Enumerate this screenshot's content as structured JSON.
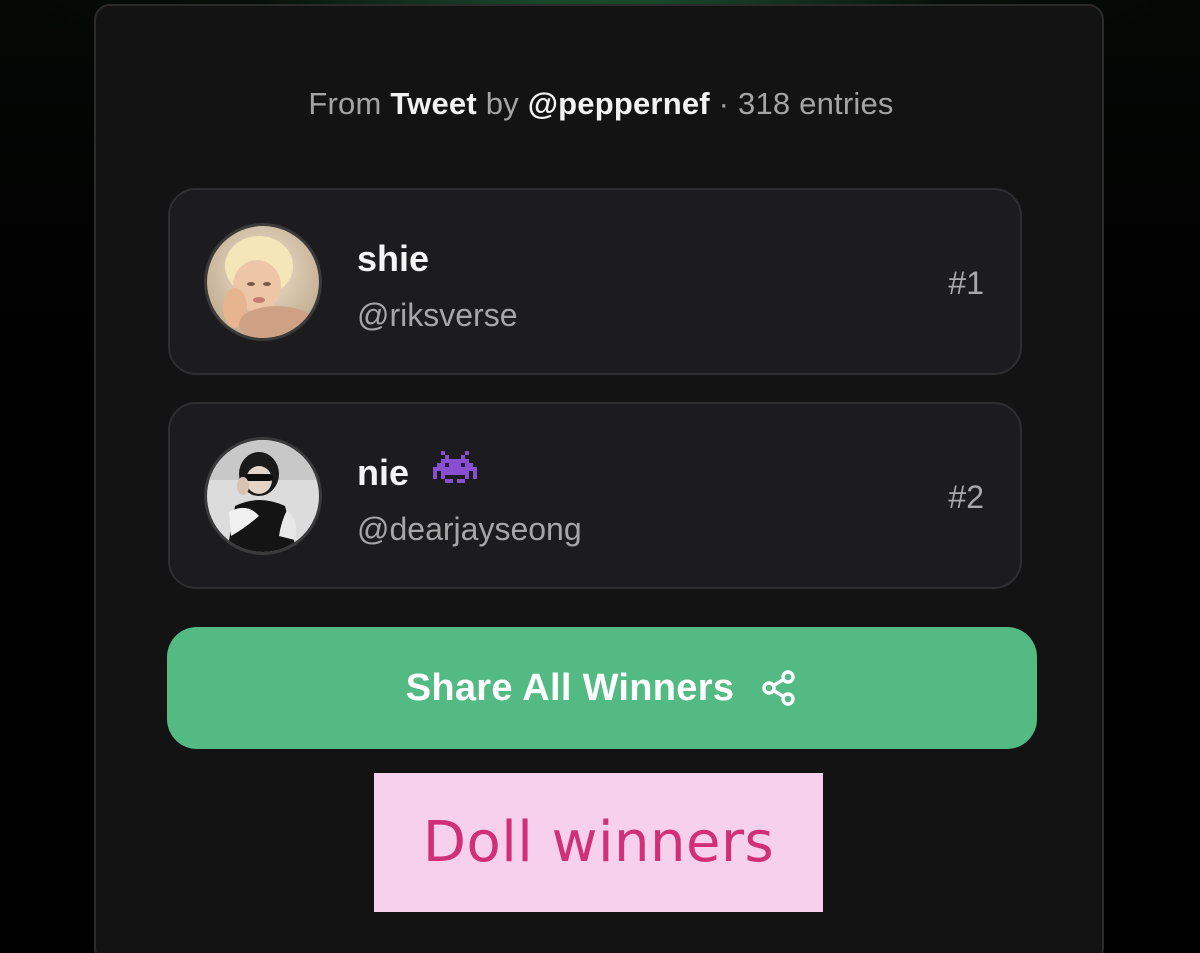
{
  "header": {
    "from_label": "From",
    "source_type": "Tweet",
    "by_label": "by",
    "author": "@peppernef",
    "separator": "·",
    "entries": "318 entries"
  },
  "winners": [
    {
      "name": "shie",
      "handle": "@riksverse",
      "rank": "#1",
      "badge_icon": ""
    },
    {
      "name": "nie",
      "handle": "@dearjayseong",
      "rank": "#2",
      "badge_icon": "alien-monster-emoji"
    }
  ],
  "share": {
    "label": "Share All Winners",
    "icon": "share-icon"
  },
  "caption": {
    "text": "Doll winners"
  },
  "colors": {
    "card_bg": "#131313",
    "row_bg": "#1c1c1e",
    "accent_green": "#52ba82",
    "caption_bg": "#f6d0ec",
    "caption_text": "#d12f78"
  }
}
